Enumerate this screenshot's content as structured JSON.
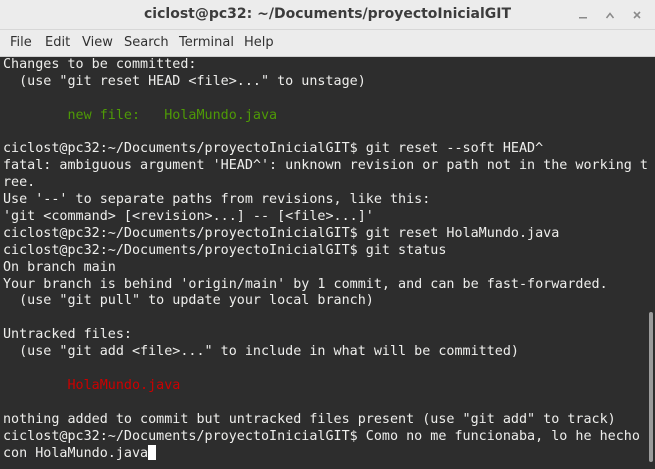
{
  "window": {
    "title": "ciclost@pc32: ~/Documents/proyectoInicialGIT"
  },
  "titlebar_buttons": {
    "minimize_icon": "minimize-icon",
    "maximize_icon": "maximize-icon",
    "close_icon": "close-icon"
  },
  "menu": {
    "file": "File",
    "edit": "Edit",
    "view": "View",
    "search": "Search",
    "terminal": "Terminal",
    "help": "Help"
  },
  "colors": {
    "terminal_bg": "#2d2d2d",
    "terminal_fg": "#eeeeec",
    "staged_green": "#4e9a06",
    "untracked_red": "#cc0000"
  },
  "terminal": {
    "lines": [
      "Changes to be committed:",
      "  (use \"git reset HEAD <file>...\" to unstage)",
      "",
      "        new file:   HolaMundo.java",
      "",
      "ciclost@pc32:~/Documents/proyectoInicialGIT$ git reset --soft HEAD^",
      "fatal: ambiguous argument 'HEAD^': unknown revision or path not in the working t",
      "ree.",
      "Use '--' to separate paths from revisions, like this:",
      "'git <command> [<revision>...] -- [<file>...]'",
      "ciclost@pc32:~/Documents/proyectoInicialGIT$ git reset HolaMundo.java",
      "ciclost@pc32:~/Documents/proyectoInicialGIT$ git status",
      "On branch main",
      "Your branch is behind 'origin/main' by 1 commit, and can be fast-forwarded.",
      "  (use \"git pull\" to update your local branch)",
      "",
      "Untracked files:",
      "  (use \"git add <file>...\" to include in what will be committed)",
      "",
      "        HolaMundo.java",
      "",
      "nothing added to commit but untracked files present (use \"git add\" to track)",
      "ciclost@pc32:~/Documents/proyectoInicialGIT$ Como no me funcionaba, lo he hecho",
      "con HolaMundo.java"
    ]
  }
}
